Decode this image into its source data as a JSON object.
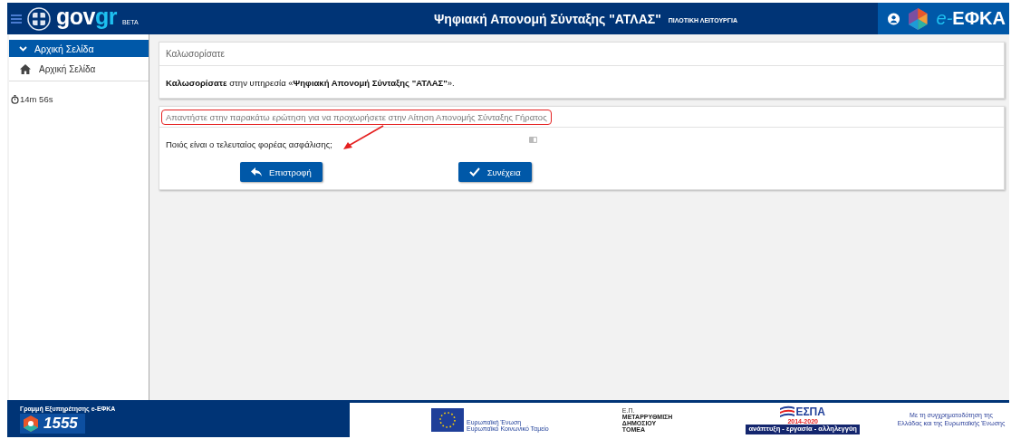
{
  "header": {
    "logo_text": "gov",
    "logo_accent": "gr",
    "logo_badge": "BETA",
    "title": "Ψηφιακή Απονομή Σύνταξης \"ΑΤΛΑΣ\"",
    "subtitle": "ΠΙΛΟΤΙΚΗ ΛΕΙΤΟΥΡΓΙΑ",
    "brand_prefix": "e-",
    "brand": "ΕΦΚΑ"
  },
  "sidebar": {
    "items": [
      {
        "label": "Αρχική Σελίδα",
        "kind": "section",
        "expanded": true,
        "selected": true,
        "children": [
          {
            "label": "Αρχική Σελίδα",
            "kind": "link",
            "selected": false
          }
        ]
      }
    ],
    "timer": "14m 56s"
  },
  "welcome_panel": {
    "heading": "Καλωσορίσατε",
    "text": "**Καλωσορίσατε** στην υπηρεσία «**Ψηφιακή Απονομή Σύνταξης \"ΑΤΛΑΣ\"**»."
  },
  "question_panel": {
    "heading": "Απαντήστε στην παρακάτω ερώτηση για να προχωρήσετε στην Αίτηση Απονομής Σύνταξης Γήρατος",
    "question": "Ποιός είναι ο τελευταίος φορέας ασφάλισης;",
    "highlighted": true,
    "buttons": [
      {
        "label": "Επιστροφή",
        "kind": "back"
      },
      {
        "label": "Συνέχεια",
        "kind": "next"
      }
    ]
  },
  "footer": {
    "hotline_title": "Γραμμή Εξυπηρέτησης e-ΕΦΚΑ",
    "hotline_number": "1555",
    "eu_label": "Ευρωπαϊκή Ένωση",
    "eu_sub": "Ευρωπαϊκό Κοινωνικό Ταμείο",
    "program_lines": [
      "Ε.Π.",
      "ΜΕΤΑΡΡΥΘΜΙΣΗ",
      "ΔΗΜΟΣΙΟΥ",
      "ΤΟΜΕΑ"
    ],
    "espa": "ΕΣΠΑ",
    "espa_years": "2014-2020",
    "espa_motto": "ανάπτυξη - εργασία - αλληλεγγύη",
    "cofunding": "Με τη συγχρηματοδότηση της Ελλάδας και της Ευρωπαϊκής Ένωσης"
  }
}
